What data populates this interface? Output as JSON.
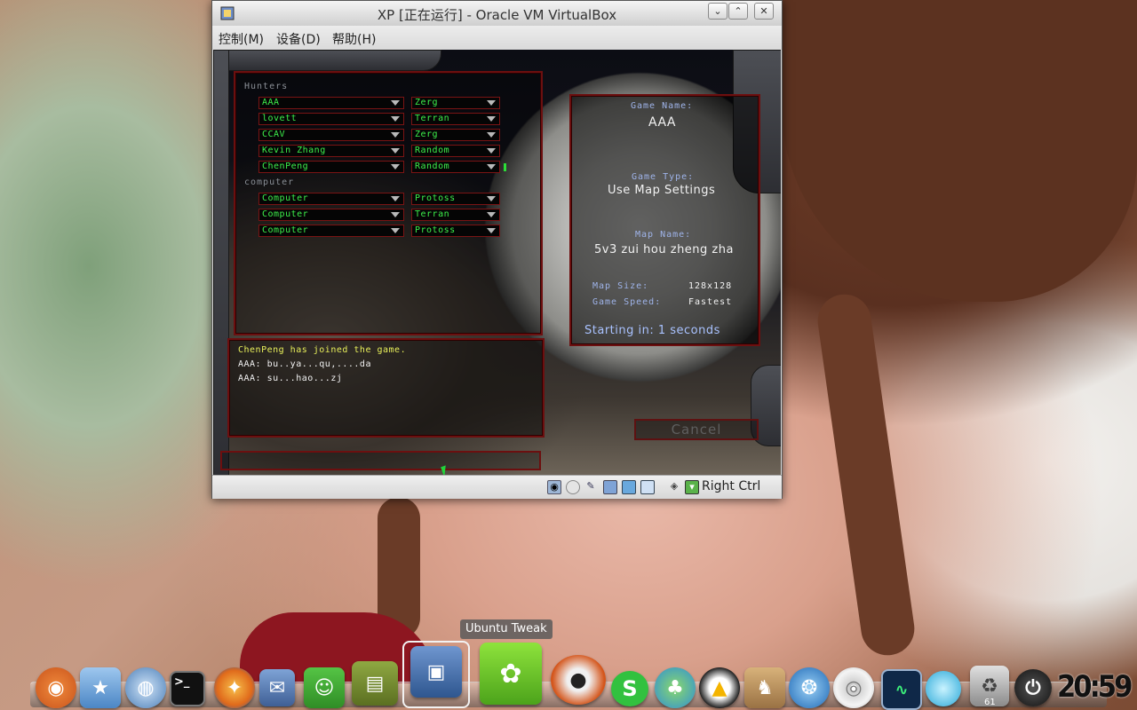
{
  "window": {
    "title": "XP [正在运行] - Oracle VM VirtualBox",
    "menu": [
      "控制(M)",
      "设备(D)",
      "帮助(H)"
    ],
    "statusbar": {
      "host_key": "Right Ctrl"
    }
  },
  "lobby": {
    "hunters_label": "Hunters",
    "computer_label": "computer",
    "hunters": [
      {
        "name": "AAA",
        "race": "Zerg"
      },
      {
        "name": "lovett",
        "race": "Terran"
      },
      {
        "name": "CCAV",
        "race": "Zerg"
      },
      {
        "name": "Kevin Zhang",
        "race": "Random"
      },
      {
        "name": "ChenPeng",
        "race": "Random"
      }
    ],
    "computers": [
      {
        "name": "Computer",
        "race": "Protoss"
      },
      {
        "name": "Computer",
        "race": "Terran"
      },
      {
        "name": "Computer",
        "race": "Protoss"
      }
    ],
    "chat": [
      {
        "text": "ChenPeng has joined the game.",
        "color": "#e8ef5a"
      },
      {
        "text": "AAA: bu..ya...qu,....da",
        "color": "#f2f2f2"
      },
      {
        "text": "AAA: su...hao...zj",
        "color": "#f2f2f2"
      }
    ],
    "info": {
      "game_name_label": "Game Name:",
      "game_name": "AAA",
      "game_type_label": "Game Type:",
      "game_type": "Use Map Settings",
      "map_name_label": "Map Name:",
      "map_name": "5v3 zui hou zheng zha",
      "map_size_label": "Map Size:",
      "map_size": "128x128",
      "game_speed_label": "Game Speed:",
      "game_speed": "Fastest",
      "starting": "Starting in: 1 seconds"
    },
    "cancel_label": "Cancel"
  },
  "dock": {
    "tooltip": "Ubuntu Tweak",
    "trash_count": "61",
    "clock": "20:59",
    "icons": [
      "ubuntu-logo-icon",
      "home-folder-icon",
      "network-globe-icon",
      "terminal-icon",
      "firefox-icon",
      "mail-stamp-icon",
      "qq-pet-icon",
      "books-icon",
      "virtualbox-icon",
      "ubuntu-tweak-icon",
      "red-panda-icon",
      "skype-icon",
      "messenger-icon",
      "qq-penguin-icon",
      "rabbit-icon",
      "blender-swirl-icon",
      "cd-disc-icon",
      "system-monitor-icon",
      "bubble-icon",
      "trash-icon",
      "power-icon"
    ]
  }
}
